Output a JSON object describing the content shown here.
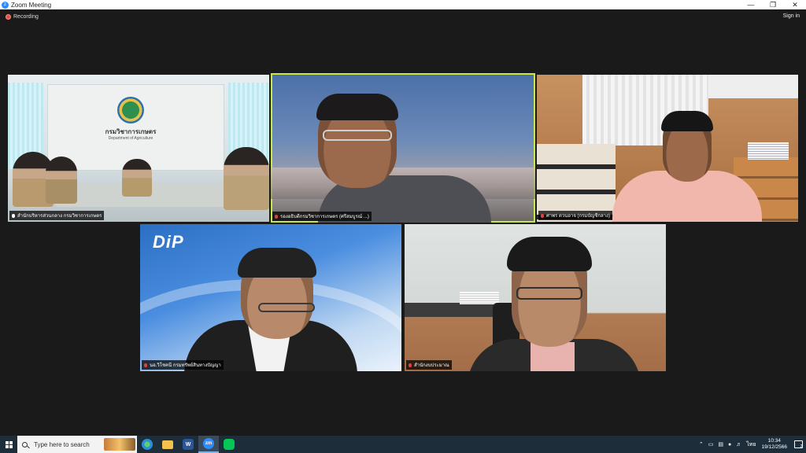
{
  "window": {
    "title": "Zoom Meeting"
  },
  "meeting": {
    "recording_label": "Recording",
    "sign_in_label": "Sign in"
  },
  "tiles": [
    {
      "name": "สำนักบริหารส่วนกลาง กรมวิชาการเกษตร",
      "muted": false,
      "active": false,
      "sign_text": "กรมวิชาการเกษตร",
      "sign_sub": "Department of Agriculture"
    },
    {
      "name": "รองอธิบดีกรมวิชาการเกษตร (ศรีสมบูรณ์ ...)",
      "muted": true,
      "active": true
    },
    {
      "name": "ศาพร ตวนอาจ (กรมบัญชีกลาง)",
      "muted": true,
      "active": false
    },
    {
      "name": "นอ.วิโชคนี กรมทรัพย์สินทางปัญญา",
      "muted": true,
      "active": false,
      "logo_text": "DiP"
    },
    {
      "name": "สำนักงบประมาณ",
      "muted": true,
      "active": false
    }
  ],
  "taskbar": {
    "search_placeholder": "Type here to search",
    "apps": [
      {
        "name": "edge-icon",
        "color": "#2a8fd8",
        "label": ""
      },
      {
        "name": "file-explorer-icon",
        "color": "#f2c14e",
        "label": ""
      },
      {
        "name": "word-icon",
        "color": "#2b579a",
        "label": "W"
      },
      {
        "name": "zoom-icon",
        "color": "#2d8cff",
        "label": "zm"
      },
      {
        "name": "line-icon",
        "color": "#06c755",
        "label": ""
      }
    ],
    "language": "ไทย",
    "time": "10:34",
    "date": "19/12/2566",
    "notification_count": "2"
  }
}
